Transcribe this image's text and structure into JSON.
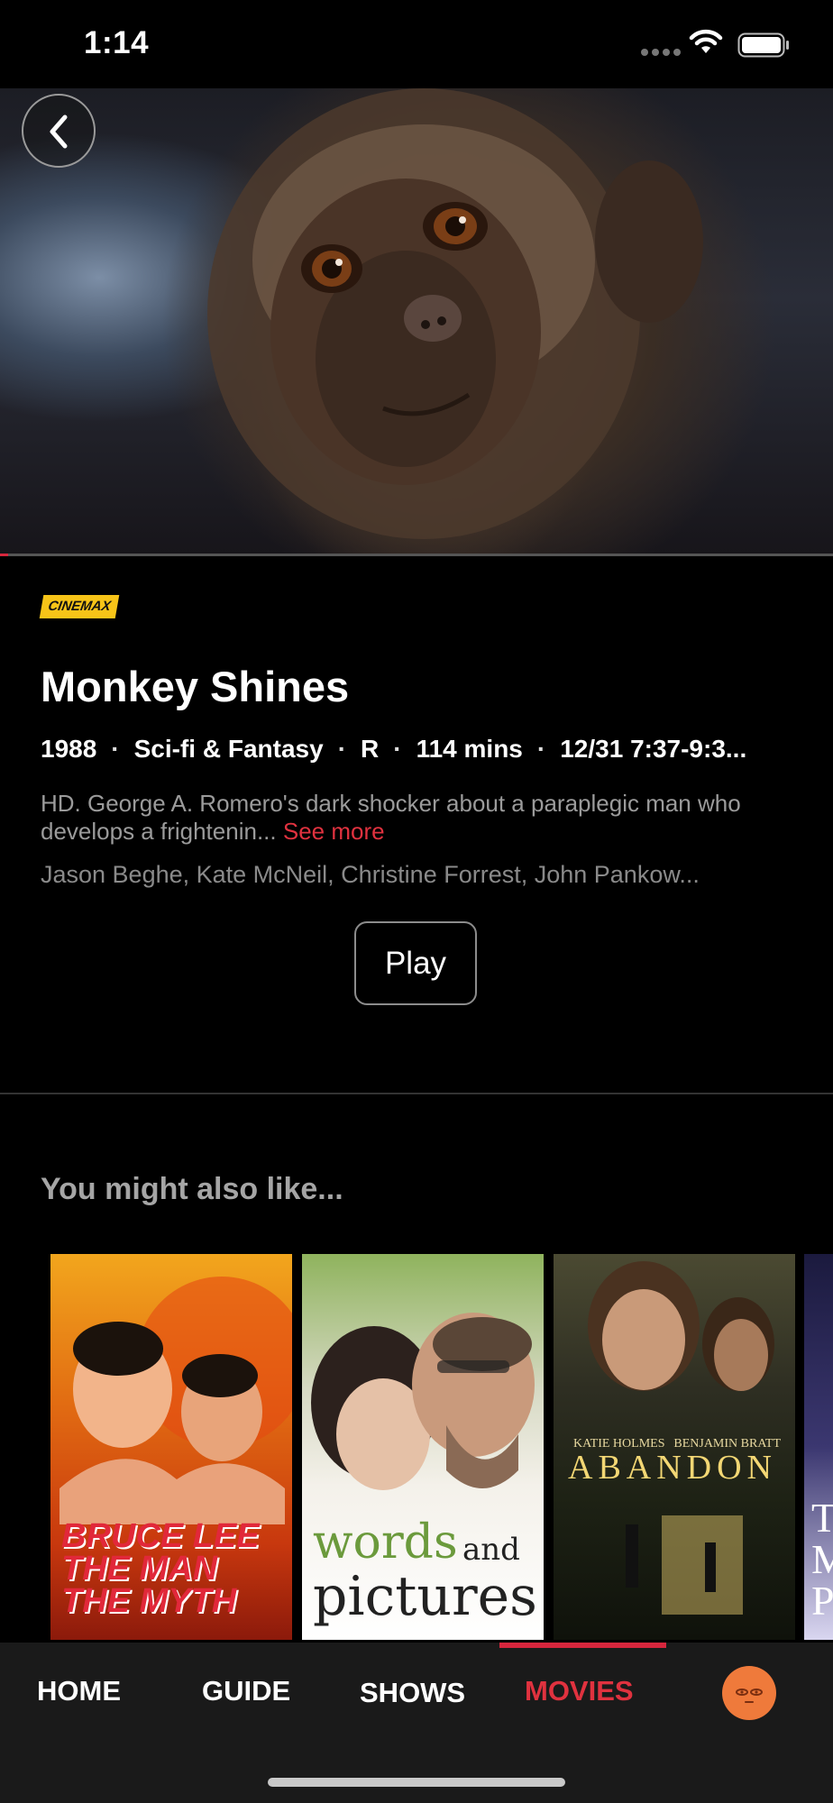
{
  "status_bar": {
    "time": "1:14",
    "icons": [
      "signal-icon",
      "wifi-icon",
      "battery-icon"
    ]
  },
  "hero": {
    "image": "capuchin monkey close-up",
    "playback_progress": 0.01
  },
  "movie": {
    "network": "CINEMAX",
    "title": "Monkey Shines",
    "year": "1988",
    "genre": "Sci-fi & Fantasy",
    "rating": "R",
    "duration": "114 mins",
    "airing": "12/31 7:37-9:3...",
    "description": "HD. George A. Romero's dark shocker about a paraplegic man who develops a frightenin...",
    "see_more": "See more",
    "cast": "Jason Beghe, Kate McNeil, Christine Forrest, John Pankow..."
  },
  "play_label": "Play",
  "recommendations": {
    "title": "You might also like...",
    "items": [
      {
        "title_text": "BRUCE LEE THE MAN THE MYTH"
      },
      {
        "title_a": "words",
        "title_b": "and",
        "title_c": "pictures"
      },
      {
        "actor_1": "KATIE HOLMES",
        "actor_2": "BENJAMIN BRATT",
        "title_text": "ABANDON"
      },
      {
        "title_text": "T M P"
      }
    ]
  },
  "tabs": [
    {
      "label": "HOME"
    },
    {
      "label": "GUIDE"
    },
    {
      "label": "SHOWS"
    },
    {
      "label": "MOVIES",
      "active": true
    }
  ],
  "colors": {
    "accent": "#d7263d",
    "background": "#000000",
    "tab_bar": "#1a1a1a",
    "network_badge": "#f7c418",
    "avatar": "#ef7a3b"
  }
}
